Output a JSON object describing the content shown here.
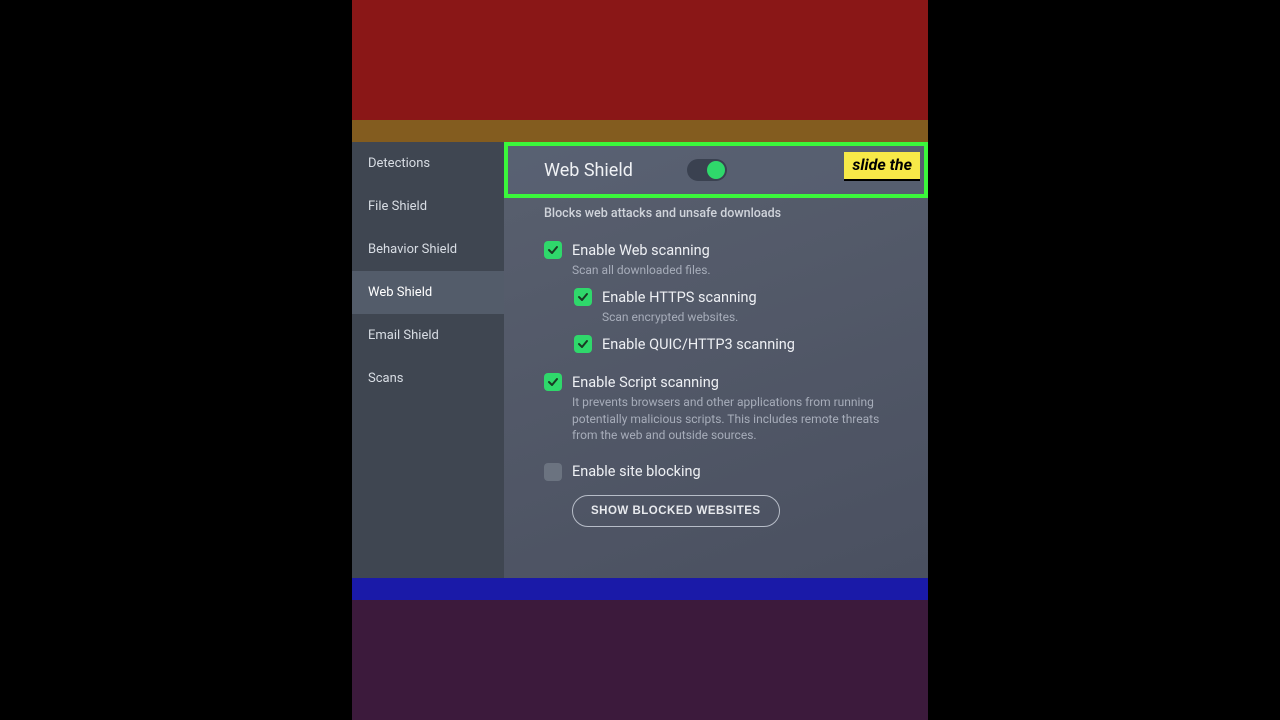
{
  "sidebar": {
    "items": [
      {
        "label": "Detections",
        "active": false
      },
      {
        "label": "File Shield",
        "active": false
      },
      {
        "label": "Behavior Shield",
        "active": false
      },
      {
        "label": "Web Shield",
        "active": true
      },
      {
        "label": "Email Shield",
        "active": false
      },
      {
        "label": "Scans",
        "active": false
      }
    ]
  },
  "header": {
    "title": "Web Shield",
    "toggle_on": true,
    "callout": "slide the"
  },
  "subtitle": "Blocks web attacks and unsafe downloads",
  "options": {
    "web_scanning": {
      "label": "Enable Web scanning",
      "desc": "Scan all downloaded files.",
      "checked": true
    },
    "https_scanning": {
      "label": "Enable HTTPS scanning",
      "desc": "Scan encrypted websites.",
      "checked": true
    },
    "quic_scanning": {
      "label": "Enable QUIC/HTTP3 scanning",
      "checked": true
    },
    "script_scanning": {
      "label": "Enable Script scanning",
      "desc": "It prevents browsers and other applications from running potentially malicious scripts. This includes remote threats from the web and outside sources.",
      "checked": true
    },
    "site_blocking": {
      "label": "Enable site blocking",
      "checked": false
    }
  },
  "buttons": {
    "show_blocked": "SHOW BLOCKED WEBSITES"
  },
  "colors": {
    "accent_green": "#2fd86b",
    "highlight_box": "#3bf73b",
    "callout_bg": "#f7e948"
  }
}
